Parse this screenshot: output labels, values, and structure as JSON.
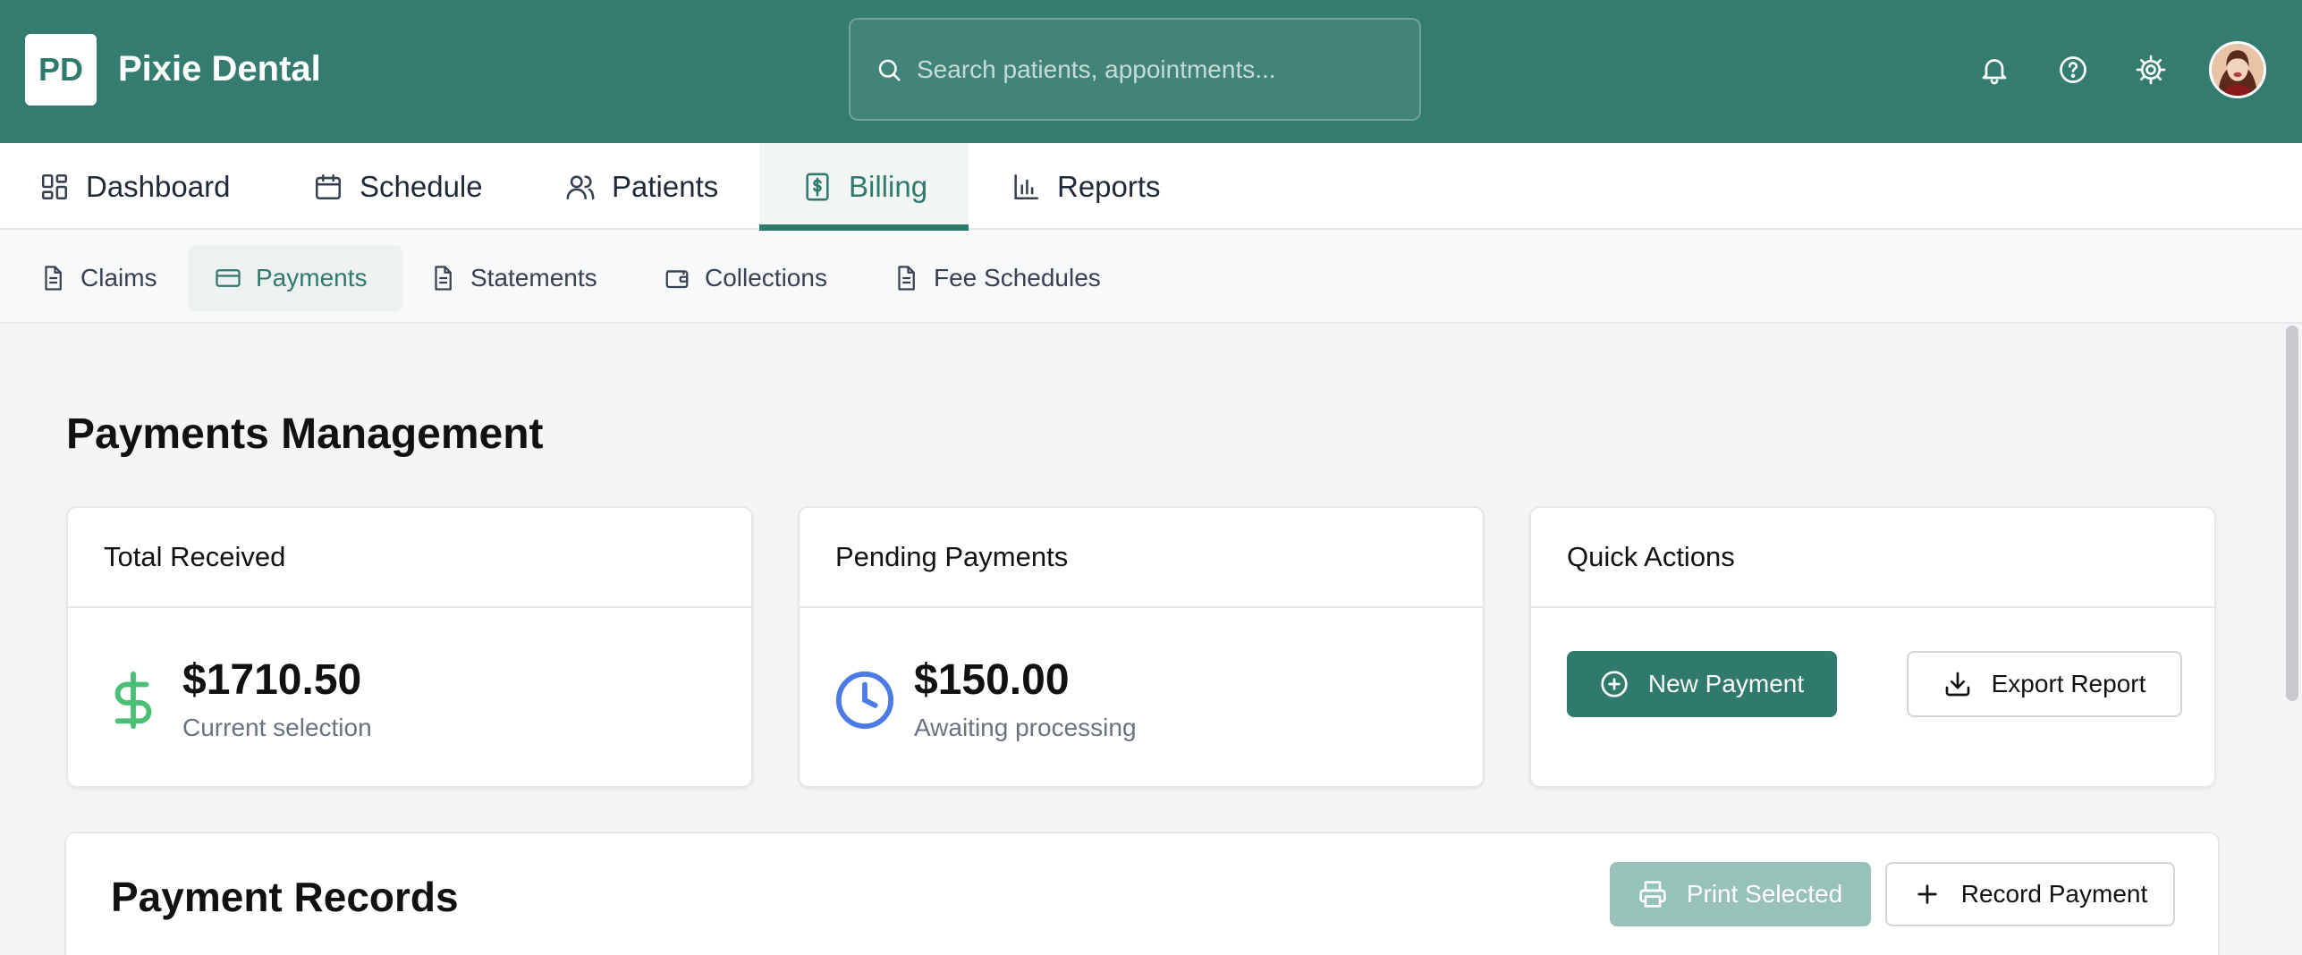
{
  "header": {
    "logo_text": "PD",
    "app_title": "Pixie Dental",
    "search_placeholder": "Search patients, appointments...",
    "icons": [
      "bell-icon",
      "help-icon",
      "settings-icon"
    ]
  },
  "main_nav": [
    {
      "label": "Dashboard",
      "icon": "dashboard-icon",
      "active": false
    },
    {
      "label": "Schedule",
      "icon": "calendar-icon",
      "active": false
    },
    {
      "label": "Patients",
      "icon": "users-icon",
      "active": false
    },
    {
      "label": "Billing",
      "icon": "receipt-dollar-icon",
      "active": true
    },
    {
      "label": "Reports",
      "icon": "bar-chart-icon",
      "active": false
    }
  ],
  "sub_nav": [
    {
      "label": "Claims",
      "icon": "document-icon",
      "active": false
    },
    {
      "label": "Payments",
      "icon": "credit-card-icon",
      "active": true
    },
    {
      "label": "Statements",
      "icon": "document-icon",
      "active": false
    },
    {
      "label": "Collections",
      "icon": "wallet-icon",
      "active": false
    },
    {
      "label": "Fee Schedules",
      "icon": "document-icon",
      "active": false
    }
  ],
  "page": {
    "title": "Payments Management"
  },
  "cards": {
    "total_received": {
      "heading": "Total Received",
      "value": "$1710.50",
      "sub": "Current selection"
    },
    "pending_payments": {
      "heading": "Pending Payments",
      "value": "$150.00",
      "sub": "Awaiting processing"
    },
    "quick_actions": {
      "heading": "Quick Actions",
      "new_payment": "New Payment",
      "export_report": "Export Report"
    }
  },
  "records": {
    "title": "Payment Records",
    "print_selected": "Print Selected",
    "record_payment": "Record Payment"
  },
  "colors": {
    "brand": "#347b70",
    "accent": "#2f7a6c",
    "money_green": "#4bbf73",
    "clock_blue": "#4a7be6"
  }
}
